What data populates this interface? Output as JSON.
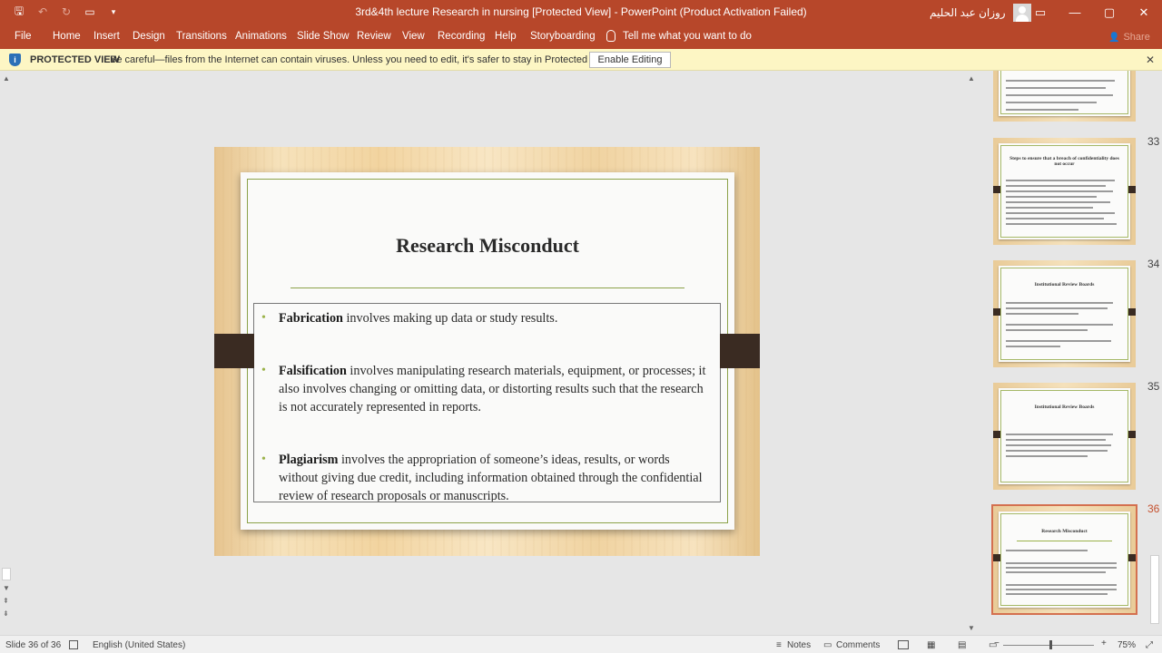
{
  "window": {
    "title": "3rd&4th  lecture Research in nursing [Protected View]  -  PowerPoint (Product Activation Failed)",
    "user_name": "روزان عبد الحليم",
    "qat": {
      "save": "🖫",
      "undo": "↶",
      "redo": "↻",
      "present": "▭",
      "more": "▾"
    },
    "controls": {
      "ribbon_display": "▭",
      "minimize": "—",
      "maximize": "▢",
      "close": "✕"
    }
  },
  "ribbon": {
    "tabs": [
      "File",
      "Home",
      "Insert",
      "Design",
      "Transitions",
      "Animations",
      "Slide Show",
      "Review",
      "View",
      "Recording",
      "Help",
      "Storyboarding"
    ],
    "tell_me": "Tell me what you want to do",
    "share": "Share",
    "share_icon": "👤"
  },
  "protected_view": {
    "title": "PROTECTED VIEW",
    "message": "Be careful—files from the Internet can contain viruses. Unless you need to edit, it's safer to stay in Protected View.",
    "enable_button": "Enable Editing",
    "close": "✕",
    "icon": "i"
  },
  "slide": {
    "title": "Research Misconduct",
    "bullets": [
      {
        "term": "Fabrication",
        "text": " involves making up data or study results."
      },
      {
        "term": "Falsification",
        "text": " involves manipulating research materials, equipment, or processes; it also involves changing or omitting data, or distorting results such that the research is not accurately represented in reports."
      },
      {
        "term": "Plagiarism",
        "text": " involves the appropriation of someone’s ideas, results, or words without giving due credit, including information obtained through the confidential review of research proposals or manuscripts."
      }
    ]
  },
  "thumbnails": [
    {
      "number": "33",
      "title": "Steps to ensure that a breach of confidentiality does not occur"
    },
    {
      "number": "34",
      "title": "Institutional Review Boards"
    },
    {
      "number": "35",
      "title": "Institutional Review Boards"
    },
    {
      "number": "36",
      "title": "Research Misconduct"
    }
  ],
  "status": {
    "slide_info": "Slide 36 of 36",
    "language": "English (United States)",
    "notes": "Notes",
    "comments": "Comments",
    "zoom": "75%",
    "zoom_minus": "−",
    "zoom_plus": "+"
  },
  "colors": {
    "accent": "#b7472a",
    "protected_bar": "#fdf6c4",
    "bullet": "#9bb24a",
    "selected_thumb": "#d4704f"
  }
}
